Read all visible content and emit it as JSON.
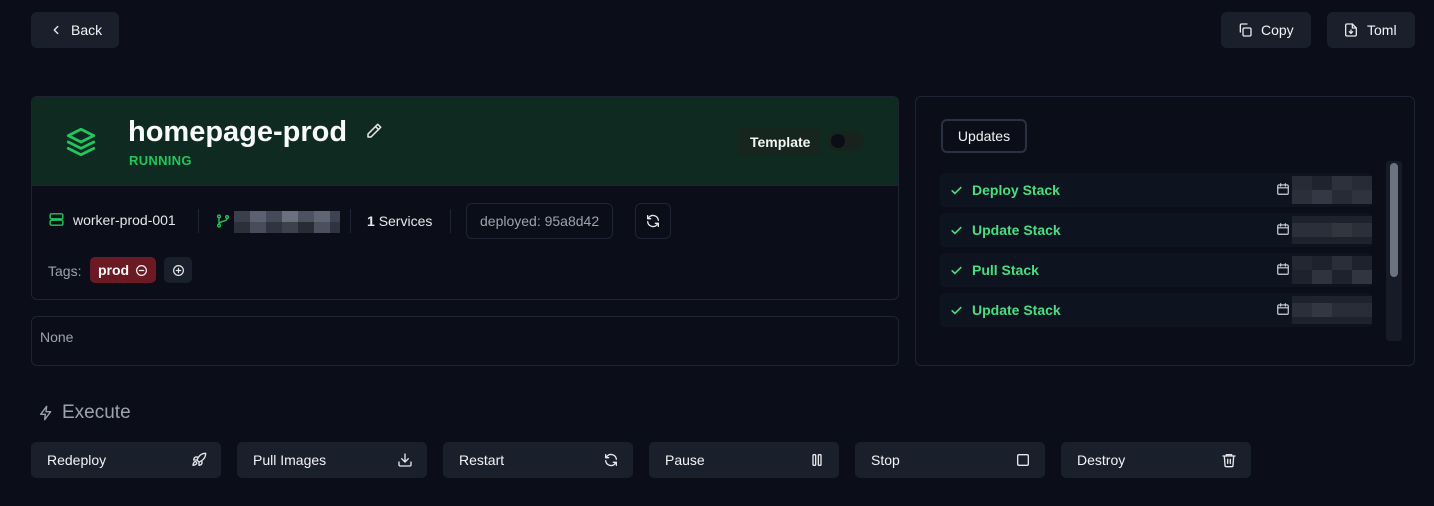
{
  "topbar": {
    "back_label": "Back",
    "copy_label": "Copy",
    "toml_label": "Toml"
  },
  "stack": {
    "name": "homepage-prod",
    "status": "RUNNING",
    "template_label": "Template",
    "template_enabled": false,
    "server": "worker-prod-001",
    "services_count": "1",
    "services_label": "Services",
    "deployed": "deployed: 95a8d42",
    "tags_label": "Tags:",
    "tags": [
      "prod"
    ],
    "description": "None",
    "accent_color": "#22c55e",
    "header_bg": "#0f2a20",
    "tag_color": "#6b1a24"
  },
  "updates": {
    "tab_label": "Updates",
    "items": [
      {
        "label": "Deploy Stack"
      },
      {
        "label": "Update Stack"
      },
      {
        "label": "Pull Stack"
      },
      {
        "label": "Update Stack"
      }
    ]
  },
  "execute": {
    "title": "Execute",
    "actions": [
      {
        "label": "Redeploy",
        "icon": "rocket-icon"
      },
      {
        "label": "Pull Images",
        "icon": "download-icon"
      },
      {
        "label": "Restart",
        "icon": "refresh-icon"
      },
      {
        "label": "Pause",
        "icon": "pause-icon"
      },
      {
        "label": "Stop",
        "icon": "stop-icon"
      },
      {
        "label": "Destroy",
        "icon": "trash-icon"
      }
    ]
  }
}
